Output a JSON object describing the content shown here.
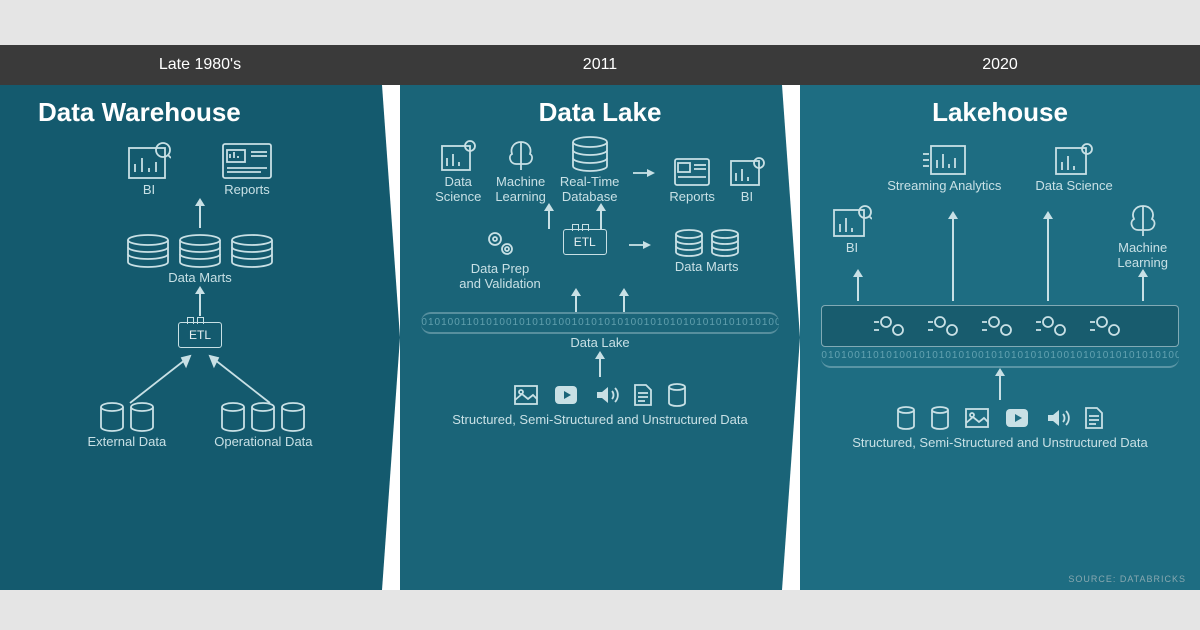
{
  "eras": {
    "e1": {
      "year": "Late 1980's",
      "title": "Data Warehouse",
      "top": [
        "BI",
        "Reports"
      ],
      "mid": "Data Marts",
      "etl": "ETL",
      "src1": "External Data",
      "src2": "Operational Data"
    },
    "e2": {
      "year": "2011",
      "title": "Data Lake",
      "r1": [
        "Data\nScience",
        "Machine\nLearning",
        "Real-Time\nDatabase",
        "Reports",
        "BI"
      ],
      "r2": [
        "Data Prep\nand Validation",
        "ETL",
        "Data Marts"
      ],
      "lake": "Data Lake",
      "bottom": "Structured, Semi-Structured and Unstructured Data"
    },
    "e3": {
      "year": "2020",
      "title": "Lakehouse",
      "r1": [
        "BI",
        "Streaming Analytics",
        "Data Science",
        "Machine\nLearning"
      ],
      "bottom": "Structured, Semi-Structured and Unstructured Data"
    }
  },
  "source": "SOURCE: DATABRICKS"
}
